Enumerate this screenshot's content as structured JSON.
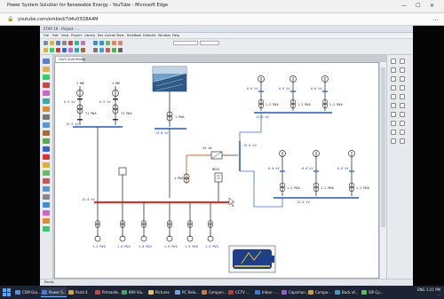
{
  "browser": {
    "window_title": "Power System Solution for Renewable Energy - YouTube - Microsoft Edge",
    "address": "youtube.com/embed/7d4v03Q8A4M",
    "minimize": "—",
    "maximize": "☐",
    "close": "✕",
    "more": "…"
  },
  "app": {
    "title": "ETAP 19 - Project - ...",
    "menus": [
      "File",
      "Edit",
      "View",
      "Project",
      "Library",
      "Rev Control",
      "Tools",
      "RuleBook",
      "Defaults",
      "Window",
      "Help"
    ],
    "tab": "OLV1 (Edit Mode)",
    "status": "Ready"
  },
  "oneline": {
    "left_gen_kv": [
      "6.9 kV",
      "6.9 kV"
    ],
    "left_transformers": [
      "T1 MVA",
      "T2 MVA"
    ],
    "left_bus_kv": "13.8 kV",
    "main_bus_label": "13.8 kV",
    "inverter_label": "40 kW",
    "transformer_a_label": "1 MVA",
    "pv_bus_label": "13.8 kV",
    "battery_label": "BESS",
    "feeder_loads": [
      "1.4 MVA",
      "1.6 MVA",
      "1.8 MVA",
      "1.6 MVA",
      "1.5 MVA",
      "1.5 MVA"
    ],
    "wind_top_kv": [
      "0.6 kV",
      "0.6 kV",
      "0.6 kV"
    ],
    "wind_top_transformers": [
      "1.2 MVA",
      "1.2 MVA",
      "1.2 MVA"
    ],
    "wind_top_bus": "13.8 kV",
    "wind_bottom_kv": [
      "0.6 kV",
      "0.6 kV",
      "0.6 kV"
    ],
    "wind_bottom_transformers": [
      "1.2 MVA",
      "1.2 MVA",
      "1.2 MVA"
    ],
    "wind_bottom_bus": "13.8 kV",
    "wind_collector_bus": "13.8 kV",
    "left_bus2": "13.8 kV"
  },
  "taskbar": {
    "items": [
      {
        "label": "CSM Gro...",
        "color": "#5b8ee6"
      },
      {
        "label": "Power S...",
        "color": "#3f7fe0"
      },
      {
        "label": "Paint 4",
        "color": "#e0a030"
      },
      {
        "label": "Primardo...",
        "color": "#d04040"
      },
      {
        "label": "899 Vio...",
        "color": "#3aa66a"
      },
      {
        "label": "Pictures",
        "color": "#e6c25a"
      },
      {
        "label": "PC Rela...",
        "color": "#6aa7e8"
      },
      {
        "label": "Compon...",
        "color": "#d07a3a"
      },
      {
        "label": "CCTV ...",
        "color": "#c03a3a"
      },
      {
        "label": "Inbox - ...",
        "color": "#2f7bd8"
      },
      {
        "label": "Capsman...",
        "color": "#9a5ad0"
      },
      {
        "label": "Compo...",
        "color": "#d0a03a"
      },
      {
        "label": "Back of...",
        "color": "#3aa0c0"
      },
      {
        "label": "SIP Cp...",
        "color": "#5ac05a"
      }
    ],
    "tray_lang": "ENG",
    "tray_time": "1:21 PM",
    "tray_date": "..."
  },
  "colors": {
    "bus_red": "#d9352b",
    "wire_blue": "#3b6fd6",
    "wire_dark": "#333333",
    "wire_orange": "#c8682a"
  }
}
